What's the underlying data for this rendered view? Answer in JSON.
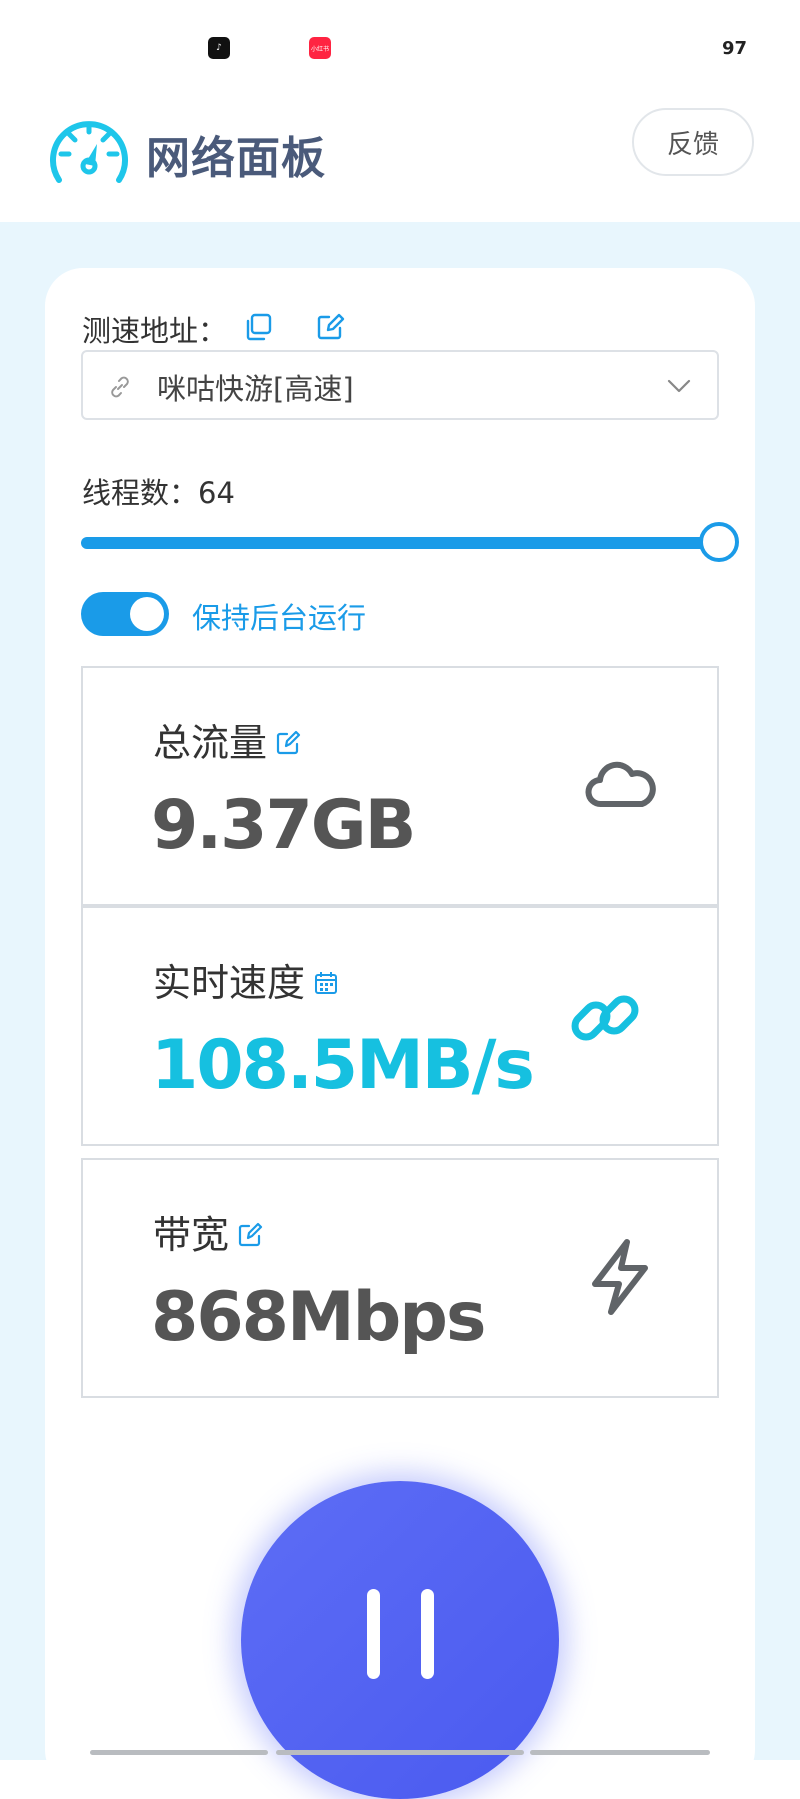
{
  "status_bar": {
    "app1_icon": "tiktok-icon",
    "app2_icon": "xiaohongshu-icon",
    "app2_label": "小红书",
    "battery": "97"
  },
  "header": {
    "title": "网络面板",
    "feedback_label": "反馈",
    "logo_icon": "speedometer-icon"
  },
  "settings": {
    "url_label": "测速地址：",
    "url_value": "咪咕快游[高速]",
    "threads_label": "线程数：",
    "threads_value": "64",
    "threads_level": 1.0,
    "keep_alive_label": "保持后台运行",
    "keep_alive_on": true
  },
  "stats": [
    {
      "label": "总流量",
      "value": "9.37GB",
      "title_icon": "edit-icon",
      "icon": "cloud-icon",
      "value_color": "#555555"
    },
    {
      "label": "实时速度",
      "value": "108.5MB/s",
      "title_icon": "calendar-icon",
      "icon": "link-icon",
      "value_color": "#16c0e0"
    },
    {
      "label": "带宽",
      "value": "868Mbps",
      "title_icon": "edit-icon",
      "icon": "lightning-icon",
      "value_color": "#555555"
    }
  ],
  "control": {
    "state": "running",
    "icon": "pause-icon"
  },
  "colors": {
    "accent": "#1a9be8",
    "cyan": "#16c0e0",
    "play": "#4f5ef2",
    "title": "#4a5a7a"
  }
}
